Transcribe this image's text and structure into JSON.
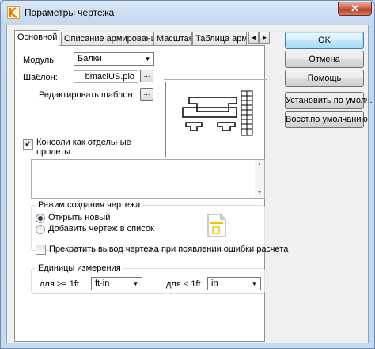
{
  "window": {
    "title": "Параметры чертежа",
    "close_glyph": "✕"
  },
  "tabs": [
    {
      "label": "Основной"
    },
    {
      "label": "Описание армирования"
    },
    {
      "label": "Масштаб"
    },
    {
      "label": "Таблица арми"
    }
  ],
  "tab_scroll": {
    "left": "◄",
    "right": "►"
  },
  "module": {
    "label": "Модуль:",
    "value": "Балки"
  },
  "template": {
    "label": "Шаблон:",
    "value": "bmaciUS.plo",
    "browse_label": "..."
  },
  "edit_template": {
    "label": "Редактировать шаблон:",
    "button_label": "..."
  },
  "consoles": {
    "label": "Консоли как отдельные пролеты",
    "checked": true
  },
  "mode_group": {
    "legend": "Режим создания чертежа",
    "options": [
      {
        "label": "Открыть новый",
        "selected": true
      },
      {
        "label": "Добавить чертеж в список",
        "selected": false
      }
    ]
  },
  "stop_output": {
    "label": "Прекратить вывод чертежа при появлении ошибки расчета",
    "checked": false
  },
  "units_group": {
    "legend": "Единицы измерения",
    "ge_label": "для >= 1ft",
    "ge_value": "ft-in",
    "lt_label": "для < 1ft",
    "lt_value": "in"
  },
  "buttons": {
    "ok": "OK",
    "cancel": "Отмена",
    "help": "Помощь",
    "set_default": "Установить по умолч.",
    "restore_default": "Восст.по умолчанию"
  },
  "colors": {
    "accent": "#3c7fb1",
    "icon_yellow": "#f5c400"
  }
}
